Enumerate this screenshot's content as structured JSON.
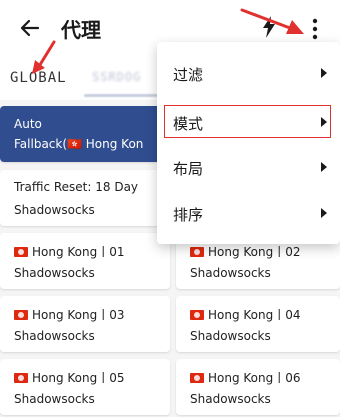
{
  "header": {
    "title": "代理",
    "back_icon": "arrow-left-icon",
    "speed_icon": "lightning-bolt-icon",
    "more_icon": "more-vertical-icon"
  },
  "tabs": [
    {
      "label": "GLOBAL",
      "selected": true
    },
    {
      "label": "SSRDOG",
      "selected": false
    }
  ],
  "proxies": [
    {
      "line1": "Auto",
      "line2": "Fallback(🇭🇰 Hong Kon",
      "selected": true
    },
    {
      "line1": "Traffic Reset: 18 Day",
      "line2": "Shadowsocks",
      "selected": false
    },
    {
      "line1": "Hong Kong丨01",
      "line2": "Shadowsocks",
      "flag": "hk-flag-icon"
    },
    {
      "line1": "Hong Kong丨02",
      "line2": "Shadowsocks",
      "flag": "hk-flag-icon"
    },
    {
      "line1": "Hong Kong丨03",
      "line2": "Shadowsocks",
      "flag": "hk-flag-icon"
    },
    {
      "line1": "Hong Kong丨04",
      "line2": "Shadowsocks",
      "flag": "hk-flag-icon"
    },
    {
      "line1": "Hong Kong丨05",
      "line2": "Shadowsocks",
      "flag": "hk-flag-icon"
    },
    {
      "line1": "Hong Kong丨06",
      "line2": "Shadowsocks",
      "flag": "hk-flag-icon"
    }
  ],
  "menu": {
    "items": [
      {
        "label": "过滤",
        "icon": "chevron-right-icon"
      },
      {
        "label": "模式",
        "icon": "chevron-right-icon",
        "highlighted": true
      },
      {
        "label": "布局",
        "icon": "chevron-right-icon"
      },
      {
        "label": "排序",
        "icon": "chevron-right-icon"
      }
    ]
  },
  "colors": {
    "selected_card": "#2f4d8f",
    "annotation_red": "#e0312e"
  }
}
